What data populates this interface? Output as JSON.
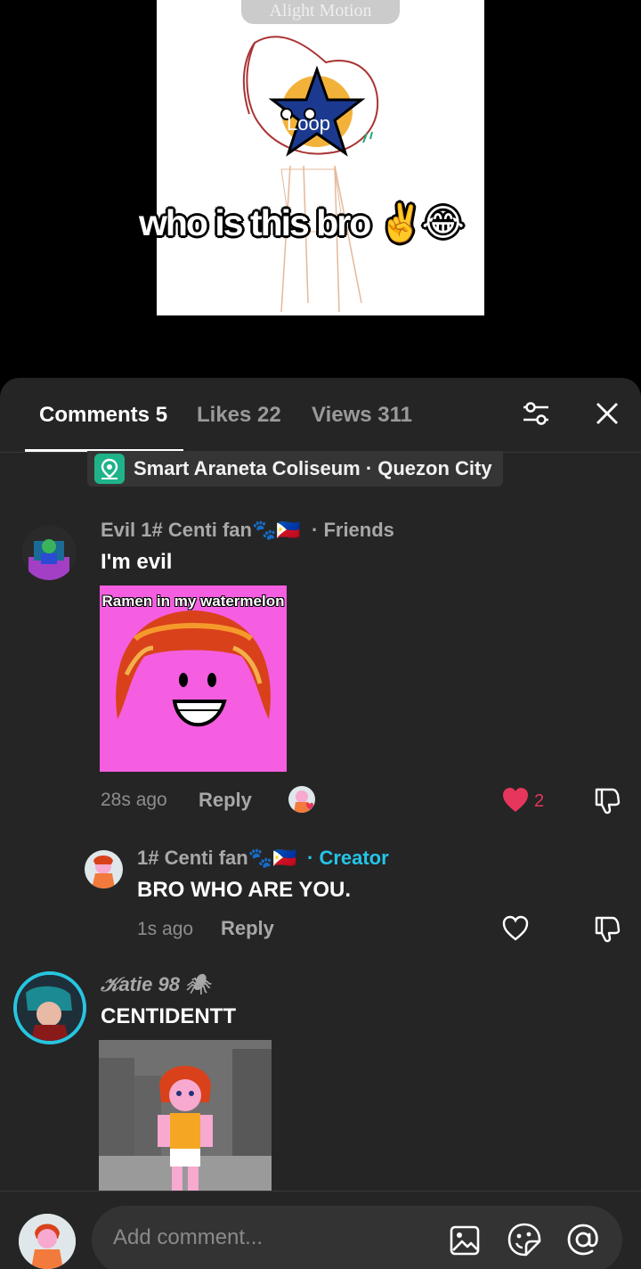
{
  "video": {
    "watermark": "Alight Motion",
    "caption": "who is this bro ✌️😂",
    "loop_label": "Loop"
  },
  "tabs": [
    {
      "label": "Comments 5",
      "active": true
    },
    {
      "label": "Likes 22",
      "active": false
    },
    {
      "label": "Views 311",
      "active": false
    }
  ],
  "location": {
    "text": "Smart Araneta Coliseum · Quezon City"
  },
  "comments": [
    {
      "author": "Evil 1# Centi fan🐾🇵🇭",
      "relation": "· Friends",
      "text": "I'm evil",
      "image_caption": "Ramen in my watermelon",
      "time": "28s ago",
      "reply_label": "Reply",
      "likes": "2",
      "liked": true
    },
    {
      "author": "1# Centi fan🐾🇵🇭",
      "relation": "· Creator",
      "text": "BRO WHO ARE YOU.",
      "time": "1s ago",
      "reply_label": "Reply",
      "liked": false
    },
    {
      "author": "𝒦atie 98 🕷",
      "text": "CENTIDENTT"
    }
  ],
  "input": {
    "placeholder": "Add comment..."
  },
  "colors": {
    "accent_like": "#e6365c",
    "creator": "#25c4e8",
    "sheet_bg": "#252525"
  }
}
